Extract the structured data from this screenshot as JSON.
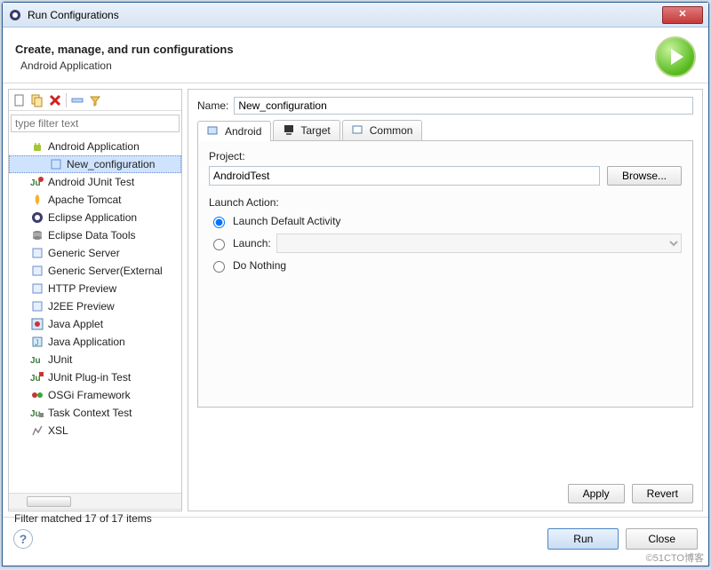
{
  "window": {
    "title": "Run Configurations"
  },
  "header": {
    "title": "Create, manage, and run configurations",
    "subtitle": "Android Application"
  },
  "sidebar": {
    "filter_placeholder": "type filter text",
    "items": [
      {
        "label": "Android Application"
      },
      {
        "label": "New_configuration",
        "sub": true,
        "selected": true
      },
      {
        "label": "Android JUnit Test"
      },
      {
        "label": "Apache Tomcat"
      },
      {
        "label": "Eclipse Application"
      },
      {
        "label": "Eclipse Data Tools"
      },
      {
        "label": "Generic Server"
      },
      {
        "label": "Generic Server(External"
      },
      {
        "label": "HTTP Preview"
      },
      {
        "label": "J2EE Preview"
      },
      {
        "label": "Java Applet"
      },
      {
        "label": "Java Application"
      },
      {
        "label": "JUnit"
      },
      {
        "label": "JUnit Plug-in Test"
      },
      {
        "label": "OSGi Framework"
      },
      {
        "label": "Task Context Test"
      },
      {
        "label": "XSL"
      }
    ],
    "status": "Filter matched 17 of 17 items"
  },
  "form": {
    "name_label": "Name:",
    "name_value": "New_configuration",
    "tabs": [
      "Android",
      "Target",
      "Common"
    ],
    "project_label": "Project:",
    "project_value": "AndroidTest",
    "browse_label": "Browse...",
    "launch_action_label": "Launch Action:",
    "options": {
      "default": "Launch Default Activity",
      "launch": "Launch:",
      "donothing": "Do Nothing"
    },
    "apply": "Apply",
    "revert": "Revert"
  },
  "footer": {
    "run": "Run",
    "close": "Close"
  },
  "credit": "©51CTO博客"
}
